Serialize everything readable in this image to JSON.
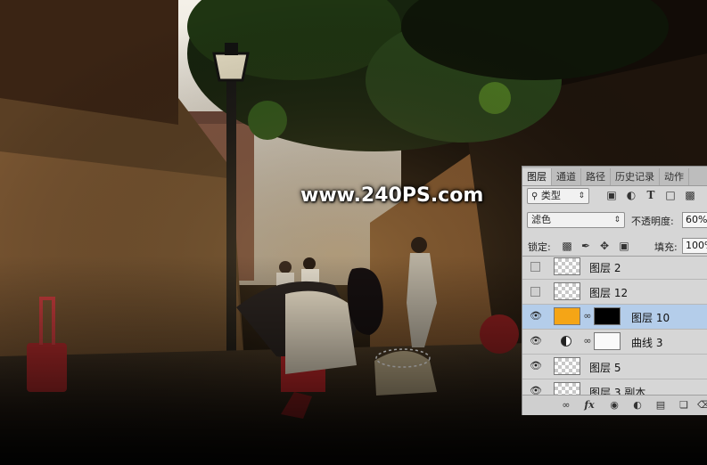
{
  "watermark": "www.240PS.com",
  "panel": {
    "tabs": [
      "图层",
      "通道",
      "路径",
      "历史记录",
      "动作"
    ],
    "active_tab": "图层",
    "filter_kind": "类型",
    "blend_mode": "滤色",
    "opacity_label": "不透明度:",
    "opacity_value": "60%",
    "lock_label": "锁定:",
    "fill_label": "填充:",
    "fill_value": "100%",
    "layers": [
      {
        "name": "图层 2",
        "visible": false,
        "selected": false
      },
      {
        "name": "图层 12",
        "visible": false,
        "selected": false
      },
      {
        "name": "图层 10",
        "visible": true,
        "selected": true,
        "fill_color": "#F5A516"
      },
      {
        "name": "曲线 3",
        "visible": true,
        "selected": false
      },
      {
        "name": "图层 5",
        "visible": true,
        "selected": false
      },
      {
        "name": "图层 3 副本",
        "visible": true,
        "selected": false
      }
    ],
    "bottom_icons": [
      "link-icon",
      "fx-icon",
      "mask-icon",
      "adjustment-icon",
      "folder-icon",
      "new-layer-icon",
      "trash-icon"
    ]
  },
  "colors": {
    "selection_highlight": "#B4CDEA",
    "panel_bg": "#D6D6D6",
    "accent_orange": "#F5A516"
  }
}
